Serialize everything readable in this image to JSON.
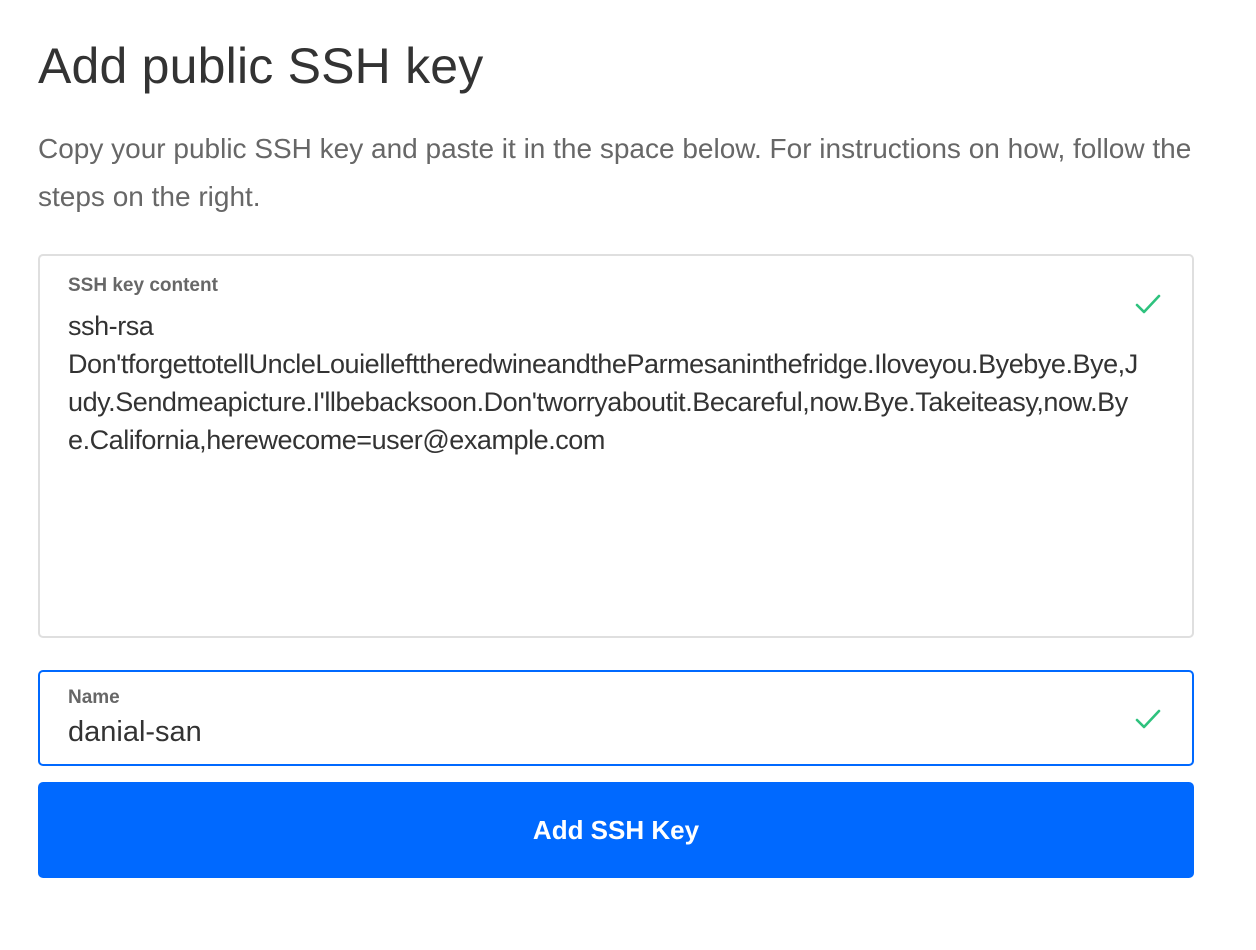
{
  "page": {
    "title": "Add public SSH key",
    "description": "Copy your public SSH key and paste it in the space below. For instructions on how, follow the steps on the right."
  },
  "ssh_key_field": {
    "label": "SSH key content",
    "value": "ssh-rsa\nDon'tforgettotellUncleLouielleftthe redwineandtheParmesaninthefridge.Iloveyou.Byebye.Bye,Judy.Sendmeapicture.I'llbebacksoon.Don'tworryaboutit.Becareful,now.Bye.Takeiteasy,now.Bye.California,herewecome=user@example.com",
    "status_icon": "check-icon",
    "status_color": "#2ec27e"
  },
  "name_field": {
    "label": "Name",
    "value": "danial-san",
    "status_icon": "check-icon",
    "status_color": "#2ec27e"
  },
  "submit_button": {
    "label": "Add SSH Key"
  },
  "colors": {
    "accent": "#0069ff",
    "valid": "#2ec27e",
    "muted_text": "#676767",
    "field_border": "#dfdfdf"
  }
}
